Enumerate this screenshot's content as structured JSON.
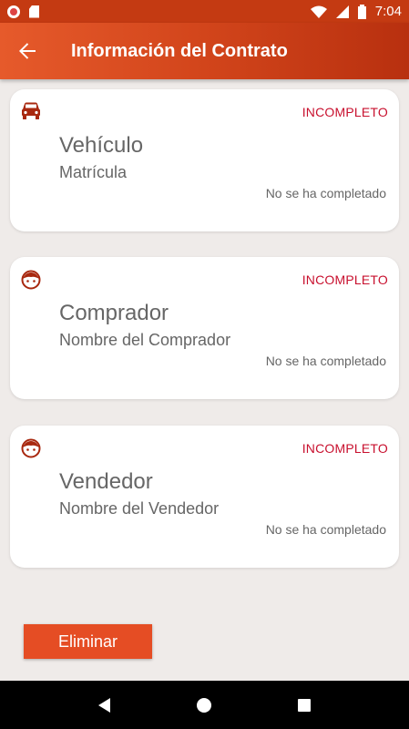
{
  "status_bar": {
    "time": "7:04",
    "icons": [
      "record-icon",
      "sd-card-icon",
      "wifi-icon",
      "signal-icon",
      "battery-icon"
    ]
  },
  "app_bar": {
    "title": "Información del Contrato",
    "back_icon": "arrow-back-icon"
  },
  "cards": [
    {
      "icon": "car-icon",
      "status": "INCOMPLETO",
      "title": "Vehículo",
      "subtitle": "Matrícula",
      "note": "No se ha completado"
    },
    {
      "icon": "face-icon",
      "status": "INCOMPLETO",
      "title": "Comprador",
      "subtitle": "Nombre del Comprador",
      "note": "No se ha completado"
    },
    {
      "icon": "face-icon",
      "status": "INCOMPLETO",
      "title": "Vendedor",
      "subtitle": "Nombre del Vendedor",
      "note": "No se ha completado"
    }
  ],
  "actions": {
    "delete_label": "Eliminar"
  },
  "nav": {
    "icons": [
      "back-triangle-icon",
      "home-circle-icon",
      "recents-square-icon"
    ]
  },
  "colors": {
    "accent": "#e54d24",
    "status_incomplete": "#c8102e",
    "app_bar": "#d2451b",
    "background": "#efebe9"
  }
}
